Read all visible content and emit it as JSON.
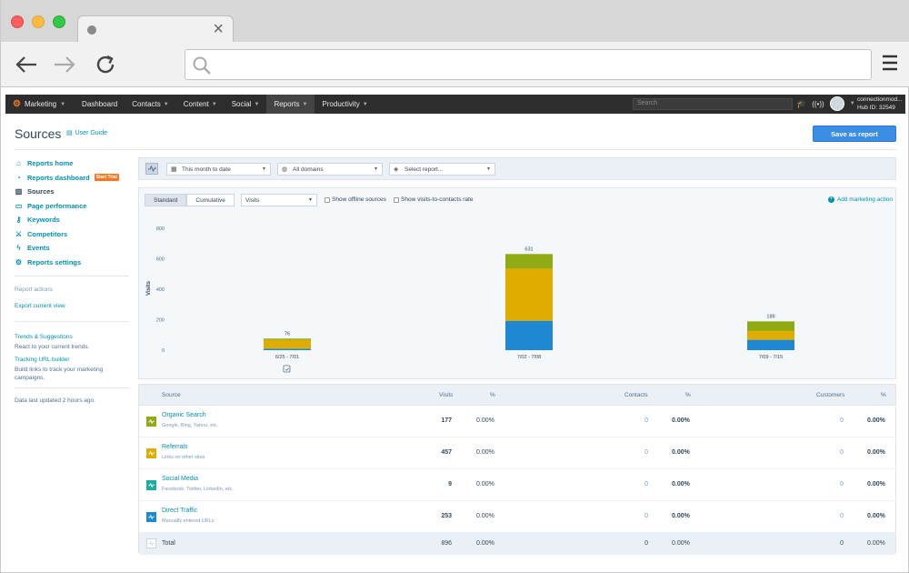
{
  "browser": {
    "tab_title": "",
    "url": ""
  },
  "appnav": {
    "brand": "Marketing",
    "items": [
      "Dashboard",
      "Contacts",
      "Content",
      "Social",
      "Reports",
      "Productivity"
    ],
    "search_placeholder": "Search",
    "account_name": "connectionmod...",
    "hub_id": "Hub ID: 32549"
  },
  "page": {
    "title": "Sources",
    "user_guide": "User Guide",
    "save_button": "Save as report"
  },
  "sidebar": {
    "items": [
      {
        "label": "Reports home",
        "icon": "home-icon"
      },
      {
        "label": "Reports dashboard",
        "icon": "dashboard-icon",
        "badge": "Start Trial"
      },
      {
        "label": "Sources",
        "icon": "bar-chart-icon",
        "current": true
      },
      {
        "label": "Page performance",
        "icon": "page-icon"
      },
      {
        "label": "Keywords",
        "icon": "key-icon"
      },
      {
        "label": "Competitors",
        "icon": "competitors-icon"
      },
      {
        "label": "Events",
        "icon": "lightning-icon"
      },
      {
        "label": "Reports settings",
        "icon": "gear-icon"
      }
    ],
    "report_actions_heading": "Report actions",
    "export_link": "Export current view",
    "trends_link": "Trends & Suggestions",
    "trends_text": "React to your current trends.",
    "tracking_link": "Tracking URL builder",
    "tracking_text": "Build links to track your marketing campaigns.",
    "updated_text": "Data last updated 2 hours ago."
  },
  "filters": {
    "date_range": "This month to date",
    "domains": "All domains",
    "report": "Select report..."
  },
  "chart_controls": {
    "standard": "Standard",
    "cumulative": "Cumulative",
    "metric": "Visits",
    "offline_label": "Show offline sources",
    "rate_label": "Show visits-to-contacts rate",
    "add_action": "Add marketing action"
  },
  "chart_data": {
    "type": "bar",
    "stacked": true,
    "ylabel": "Visits",
    "ylim": [
      0,
      800
    ],
    "yticks": [
      0,
      200,
      400,
      600,
      800
    ],
    "categories": [
      "6/25 - 7/01",
      "7/02 - 7/08",
      "7/09 - 7/15"
    ],
    "totals": [
      76,
      631,
      189
    ],
    "series": [
      {
        "name": "Direct Traffic",
        "color": "#1e88d3",
        "values": [
          10,
          193,
          68
        ]
      },
      {
        "name": "Referrals",
        "color": "#e0ac00",
        "values": [
          57,
          342,
          58
        ]
      },
      {
        "name": "Organic Search",
        "color": "#8faa12",
        "values": [
          9,
          96,
          63
        ]
      }
    ],
    "grid": false
  },
  "table": {
    "headers": {
      "source": "Source",
      "visits": "Visits",
      "pct1": "%",
      "contacts": "Contacts",
      "pct2": "%",
      "customers": "Customers",
      "pct3": "%"
    },
    "rows": [
      {
        "name": "Organic Search",
        "sub": "Google, Bing, Yahoo, etc.",
        "color": "#8faa12",
        "visits": "177",
        "visits_pct": "0.00%",
        "contacts": "0",
        "contacts_pct": "0.00%",
        "customers": "0",
        "customers_pct": "0.00%"
      },
      {
        "name": "Referrals",
        "sub": "Links on other sites",
        "color": "#e0ac00",
        "visits": "457",
        "visits_pct": "0.00%",
        "contacts": "0",
        "contacts_pct": "0.00%",
        "customers": "0",
        "customers_pct": "0.00%"
      },
      {
        "name": "Social Media",
        "sub": "Facebook, Twitter, LinkedIn, etc.",
        "color": "#1aae9f",
        "visits": "9",
        "visits_pct": "0.00%",
        "contacts": "0",
        "contacts_pct": "0.00%",
        "customers": "0",
        "customers_pct": "0.00%"
      },
      {
        "name": "Direct Traffic",
        "sub": "Manually entered URLs",
        "color": "#1e88d3",
        "visits": "253",
        "visits_pct": "0.00%",
        "contacts": "0",
        "contacts_pct": "0.00%",
        "customers": "0",
        "customers_pct": "0.00%"
      }
    ],
    "total": {
      "label": "Total",
      "visits": "896",
      "visits_pct": "0.00%",
      "contacts": "0",
      "contacts_pct": "0.00%",
      "customers": "0",
      "customers_pct": "0.00%"
    }
  }
}
